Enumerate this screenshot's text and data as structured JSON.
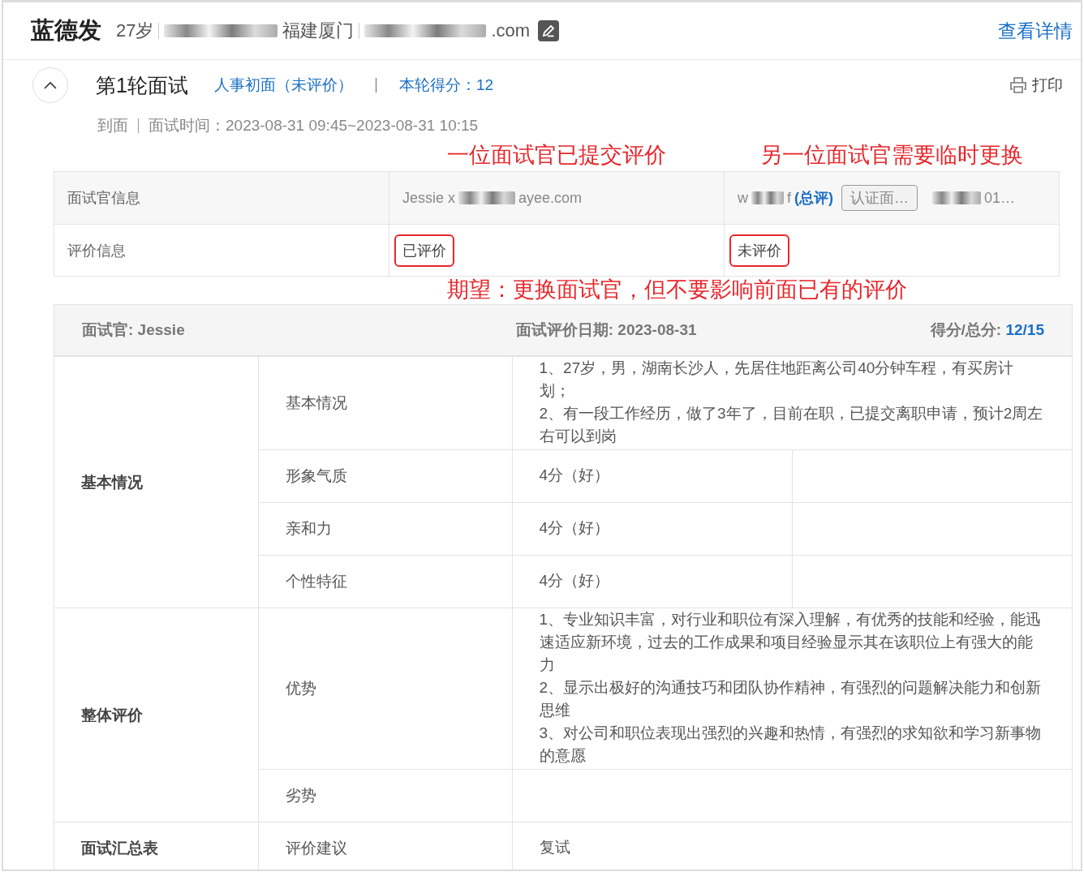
{
  "candidate": {
    "name": "蓝德发",
    "age": "27岁",
    "location": "福建厦门",
    "email_tail": ".com"
  },
  "details_link": "查看详情",
  "round": {
    "expanded": true,
    "title": "第1轮面试",
    "stage": "人事初面（未评价）",
    "score": "本轮得分：12",
    "print": "打印",
    "attendance": "到面",
    "time": "面试时间：2023-08-31 09:45~2023-08-31 10:15"
  },
  "annotations": [
    "一位面试官已提交评价",
    "另一位面试官需要临时更换",
    "期望：更换面试官，但不要影响前面已有的评价"
  ],
  "interviewer_table": {
    "info_label": "面试官信息",
    "status_label": "评价信息",
    "interviewers": [
      {
        "name_start": "Jessie x",
        "name_end": "ayee.com",
        "status": "已评价",
        "highlighted": true
      },
      {
        "name_start": "w",
        "name_end": "f",
        "summary_tag": "(总评)",
        "verify_button": "认证面…",
        "contact_end": "01…",
        "status": "未评价",
        "highlighted": true
      }
    ]
  },
  "evaluation": {
    "interviewer": "面试官: Jessie",
    "date": "面试评价日期: 2023-08-31",
    "score_label": "得分/总分: ",
    "score": "12/15",
    "groups": [
      {
        "name": "基本情况",
        "items": [
          {
            "kind": "text",
            "label": "基本情况",
            "lines": [
              "1、27岁，男，湖南长沙人，先居住地距离公司40分钟车程，有买房计划；",
              "2、有一段工作经历，做了3年了，目前在职，已提交离职申请，预计2周左右可以到岗"
            ]
          },
          {
            "kind": "score",
            "label": "形象气质",
            "lines": [
              "4分（好）"
            ]
          },
          {
            "kind": "score",
            "label": "亲和力",
            "lines": [
              "4分（好）"
            ]
          },
          {
            "kind": "score",
            "label": "个性特征",
            "lines": [
              "4分（好）"
            ]
          }
        ]
      },
      {
        "name": "整体评价",
        "items": [
          {
            "kind": "text",
            "label": "优势",
            "lines": [
              "1、专业知识丰富，对行业和职位有深入理解，有优秀的技能和经验，能迅速适应新环境，过去的工作成果和项目经验显示其在该职位上有强大的能力",
              "2、显示出极好的沟通技巧和团队协作精神，有强烈的问题解决能力和创新思维",
              "3、对公司和职位表现出强烈的兴趣和热情，有强烈的求知欲和学习新事物的意愿"
            ]
          },
          {
            "kind": "text",
            "label": "劣势"
          }
        ]
      },
      {
        "name": "面试汇总表",
        "items": [
          {
            "kind": "text",
            "label": "评价建议",
            "lines": [
              "复试"
            ]
          }
        ]
      }
    ]
  }
}
